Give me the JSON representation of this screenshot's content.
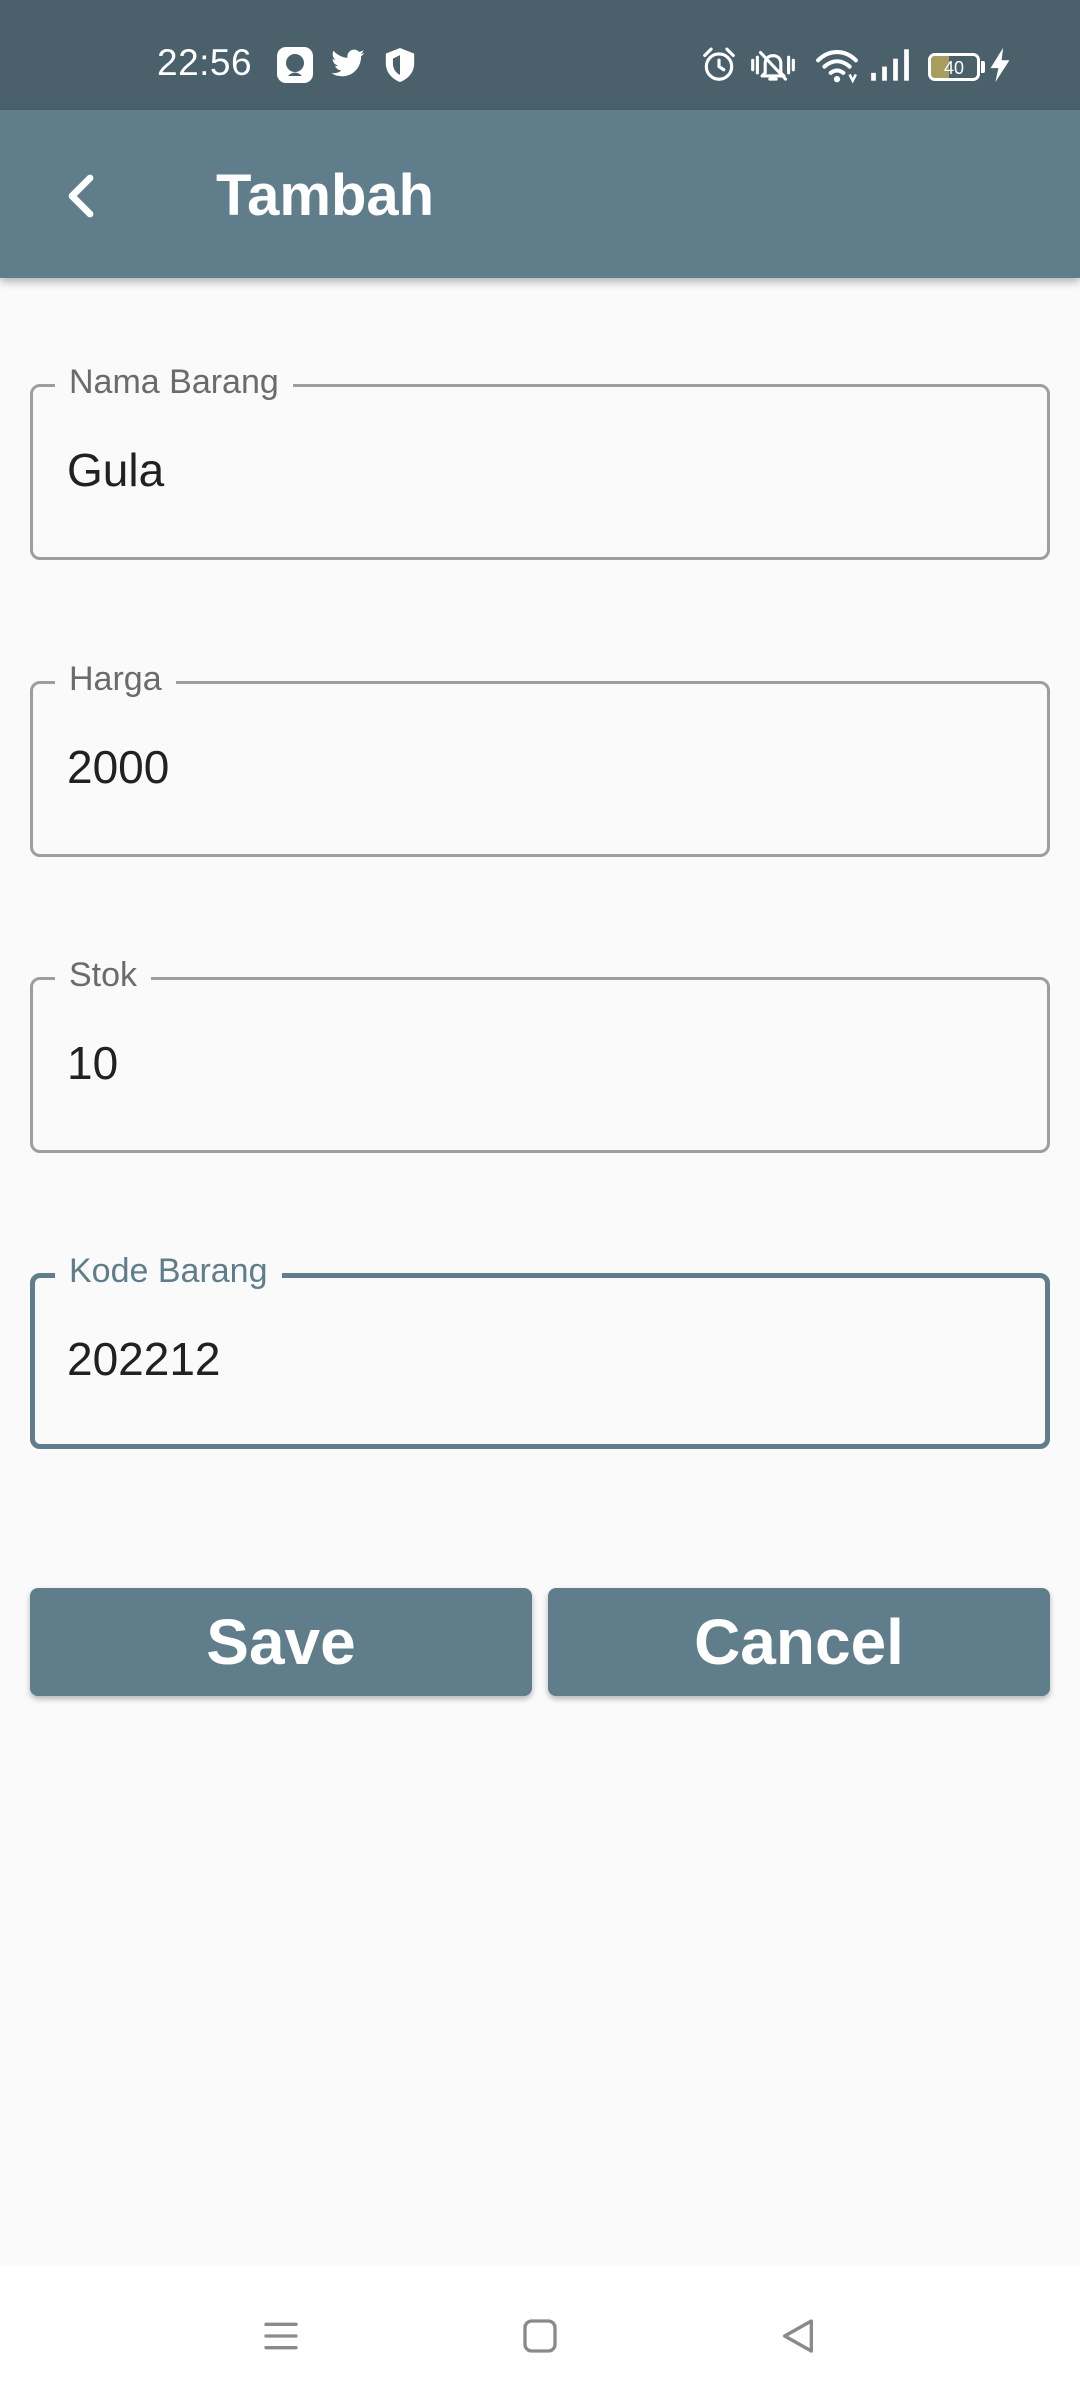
{
  "status_bar": {
    "time": "22:56",
    "battery_level": "40",
    "battery_fraction": 0.4,
    "icons_left": [
      "bubble-notification-icon",
      "twitter-icon",
      "shield-icon"
    ],
    "icons_right": [
      "alarm-icon",
      "vibrate-silent-icon",
      "wifi-icon",
      "cellular-signal-icon",
      "battery-icon",
      "charging-bolt-icon"
    ]
  },
  "app_bar": {
    "title": "Tambah",
    "back_icon": "chevron-left-icon"
  },
  "form": {
    "fields": [
      {
        "label": "Nama Barang",
        "value": "Gula",
        "focused": false
      },
      {
        "label": "Harga",
        "value": "2000",
        "focused": false
      },
      {
        "label": "Stok",
        "value": "10",
        "focused": false
      },
      {
        "label": "Kode Barang",
        "value": "202212",
        "focused": true
      }
    ]
  },
  "buttons": {
    "save": "Save",
    "cancel": "Cancel"
  },
  "nav_bar": {
    "icons": [
      "menu-icon",
      "home-icon",
      "back-triangle-icon"
    ]
  },
  "colors": {
    "status_bar": "#4a606b",
    "primary": "#607d8b",
    "background": "#fafafa",
    "field_border": "#9e9e9e",
    "label_text": "#6b6b6b",
    "value_text": "#212121",
    "battery_fill": "#a89f5e"
  }
}
